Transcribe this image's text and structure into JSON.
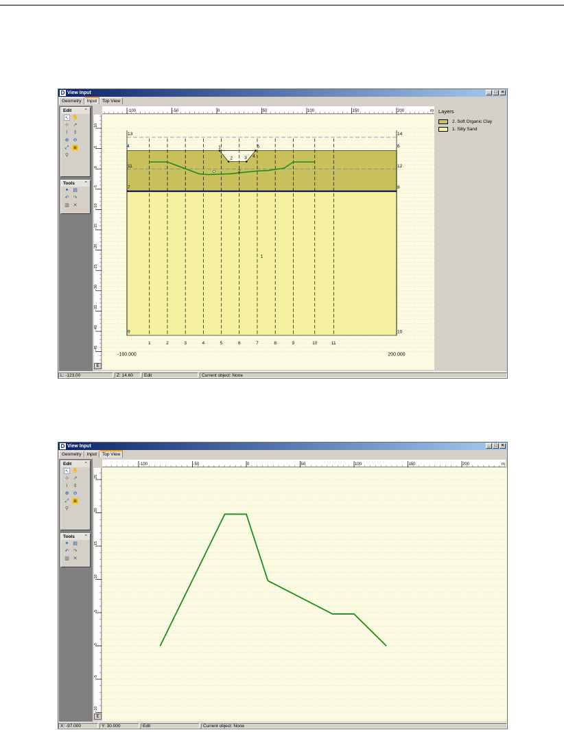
{
  "figure1": {
    "window_title": "View Input",
    "tabs": [
      "Geometry",
      "Input",
      "Top View"
    ],
    "active_tab": "Input",
    "toolbox": {
      "edit_label": "Edit",
      "tools_label": "Tools"
    },
    "ruler_h_labels": [
      "-100",
      "-50",
      "0",
      "50",
      "100",
      "150",
      "200",
      "m"
    ],
    "ruler_v_labels": [
      "10",
      "5",
      "0",
      "-5",
      "-10",
      "-15",
      "-20",
      "-25",
      "-30",
      "-35",
      "-40",
      "-45"
    ],
    "corner_label": "E",
    "layers_panel": {
      "title": "Layers",
      "items": [
        {
          "label": "2. Soft Organic Clay",
          "color": "#c8c05a"
        },
        {
          "label": "1. Silty Sand",
          "color": "#f4f0a0"
        }
      ]
    },
    "point_labels": [
      "13",
      "14",
      "4",
      "6",
      "11",
      "12",
      "7",
      "8",
      "9",
      "10",
      "1",
      "2",
      "3",
      "4",
      "5"
    ],
    "vertical_labels": [
      "1",
      "2",
      "3",
      "4",
      "5",
      "6",
      "7",
      "8",
      "9",
      "10",
      "11"
    ],
    "layer_number_labels": [
      "2",
      "1"
    ],
    "bottom_left_value": "-100.000",
    "bottom_right_value": "200.000",
    "status": {
      "l": "L: -123.00",
      "z": "Z: 14.60",
      "mode": "Edit",
      "object": "Current object: None"
    }
  },
  "figure2": {
    "window_title": "View Input",
    "tabs": [
      "Geometry",
      "Input",
      "Top View"
    ],
    "active_tab": "Top View",
    "toolbox": {
      "edit_label": "Edit",
      "tools_label": "Tools"
    },
    "ruler_h_labels": [
      "-100",
      "-50",
      "0",
      "50",
      "100",
      "150",
      "200",
      "m"
    ],
    "ruler_v_labels": [
      "25",
      "20",
      "15",
      "10",
      "5",
      "0",
      "-5",
      "-10",
      "-15"
    ],
    "corner_label": "E",
    "status": {
      "x": "X: -97.000",
      "y": "Y: 30.000",
      "mode": "Edit",
      "object": "Current object: None"
    }
  },
  "colors": {
    "line_green": "#1e8c1e",
    "phreatic_blue": "#101080",
    "clay": "#c8c05a",
    "sand": "#f4f0a0",
    "plot_bg": "#fbfbe2"
  }
}
